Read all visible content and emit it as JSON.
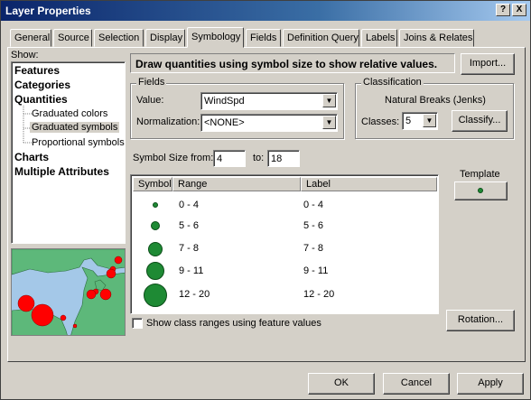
{
  "window": {
    "title": "Layer Properties",
    "help_btn": "?",
    "close_btn": "X"
  },
  "tabs": [
    "General",
    "Source",
    "Selection",
    "Display",
    "Symbology",
    "Fields",
    "Definition Query",
    "Labels",
    "Joins & Relates"
  ],
  "active_tab": "Symbology",
  "show": {
    "label": "Show:",
    "items": [
      {
        "label": "Features"
      },
      {
        "label": "Categories"
      },
      {
        "label": "Quantities"
      },
      {
        "label": "Graduated colors"
      },
      {
        "label": "Graduated symbols"
      },
      {
        "label": "Proportional symbols"
      },
      {
        "label": "Charts"
      },
      {
        "label": "Multiple Attributes"
      }
    ],
    "selected": "Graduated symbols"
  },
  "description": "Draw quantities using symbol size to show relative values.",
  "import_button": "Import...",
  "fields": {
    "group_label": "Fields",
    "value_label": "Value:",
    "value": "WindSpd",
    "normalization_label": "Normalization:",
    "normalization": "<NONE>"
  },
  "classification": {
    "group_label": "Classification",
    "method": "Natural Breaks (Jenks)",
    "classes_label": "Classes:",
    "classes": "5",
    "classify_button": "Classify..."
  },
  "symbol_size": {
    "from_label": "Symbol Size from:",
    "from": "4",
    "to_label": "to:",
    "to": "18"
  },
  "table": {
    "headers": [
      "Symbol",
      "Range",
      "Label"
    ],
    "rows": [
      {
        "range": "0 - 4",
        "label": "0 - 4"
      },
      {
        "range": "5 - 6",
        "label": "5 - 6"
      },
      {
        "range": "7 - 8",
        "label": "7 - 8"
      },
      {
        "range": "9 - 11",
        "label": "9 - 11"
      },
      {
        "range": "12 - 20",
        "label": "12 - 20"
      }
    ]
  },
  "template": {
    "label": "Template"
  },
  "rotation_button": "Rotation...",
  "show_class_ranges": {
    "label": "Show class ranges using feature values",
    "checked": false
  },
  "buttons": {
    "ok": "OK",
    "cancel": "Cancel",
    "apply": "Apply"
  },
  "colors": {
    "symbol_fill": "#1e8a34",
    "title_bar": "#0a246a",
    "map_water": "#a4c8e8",
    "map_land": "#5db87a",
    "map_marker": "#ff0000"
  }
}
